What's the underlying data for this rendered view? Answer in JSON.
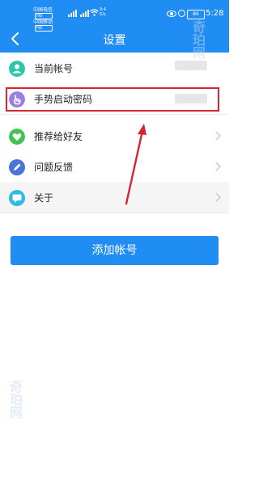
{
  "status_bar": {
    "carrier_1": "中国电信",
    "carrier_2": "中国移动",
    "hd_badge": "HD",
    "network_speed": "9.4",
    "network_unit": "K/s",
    "battery": "86",
    "time": "5:28"
  },
  "header": {
    "title": "设置",
    "back_icon": "chevron-left-icon"
  },
  "menu": {
    "items": [
      {
        "label": "当前帐号",
        "icon": "user-icon",
        "color": "#2cc6a8"
      },
      {
        "label": "手势启动密码",
        "icon": "hand-icon",
        "color": "#9b7fe0"
      },
      {
        "label": "推荐给好友",
        "icon": "heart-icon",
        "color": "#44c057"
      },
      {
        "label": "问题反馈",
        "icon": "pen-icon",
        "color": "#4a74d8"
      },
      {
        "label": "关于",
        "icon": "chat-icon",
        "color": "#2fb9e8"
      }
    ]
  },
  "actions": {
    "add_account": "添加帐号"
  },
  "watermark": {
    "text": "奇珀网"
  },
  "colors": {
    "primary": "#1f8df3",
    "highlight": "#d3262f"
  }
}
